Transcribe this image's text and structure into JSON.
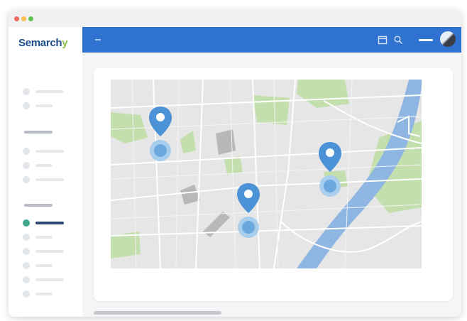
{
  "app": {
    "logo_text": "Semarch",
    "logo_accent": "y",
    "brand_color": "#2f72cf",
    "accent_color": "#3fa88e"
  },
  "window_controls": [
    {
      "name": "close",
      "color": "#ec6a5e"
    },
    {
      "name": "minimize",
      "color": "#f4bf4f"
    },
    {
      "name": "maximize",
      "color": "#61c554"
    }
  ],
  "topbar": {
    "icons": [
      "menu-icon",
      "calendar-icon",
      "search-icon",
      "user-avatar"
    ]
  },
  "sidebar": {
    "active_section": 3,
    "active_item": 0,
    "sections_item_counts": [
      2,
      3,
      6
    ]
  },
  "map": {
    "pins": 3
  }
}
